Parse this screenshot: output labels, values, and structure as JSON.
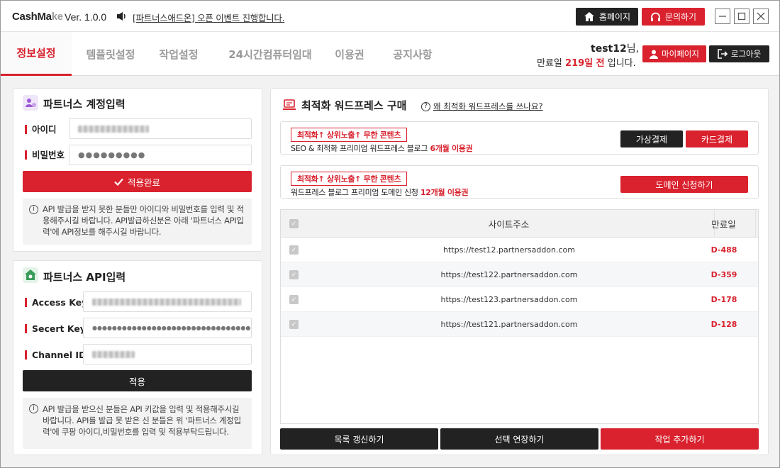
{
  "app": {
    "logo_prefix": "CashMa",
    "logo_suffix": "ke",
    "version": "Ver. 1.0.0",
    "notice": "[파트너스애드온] 오픈 이벤트 진행합니다."
  },
  "titlebar": {
    "home_label": "홈페이지",
    "ask_label": "문의하기"
  },
  "nav": {
    "tabs": [
      {
        "label": "정보설정",
        "active": true
      },
      {
        "label": "템플릿설정",
        "active": false
      },
      {
        "label": "작업설정",
        "active": false
      },
      {
        "label": "24시간컴퓨터임대",
        "active": false
      },
      {
        "label": "이용권",
        "active": false
      },
      {
        "label": "공지사항",
        "active": false
      }
    ],
    "username": "test12",
    "username_suffix": "님,",
    "expire_prefix": "만료일",
    "expire_value": "219일 전",
    "expire_suffix": "입니다.",
    "mypage_label": "마이페이지",
    "logout_label": "로그아웃"
  },
  "account": {
    "title": "파트너스 계정입력",
    "id_label": "아이디",
    "pw_label": "비밀번호",
    "pw_mask": "●●●●●●●●●",
    "apply_label": "적용완료",
    "info": "API 발급을 받지 못한 분들만 아이디와 비밀번호를 입력 및 적용해주시길 바랍니다.  API발급하신분은 아래 '파트너스 API입력'에 API정보를 해주시길 바랍니다."
  },
  "api": {
    "title": "파트너스 API입력",
    "access_label": "Access Key",
    "secret_label": "Secert Key",
    "secret_mask": "●●●●●●●●●●●●●●●●●●●●●●●●●●●●●●●●●●●●",
    "channel_label": "Channel ID",
    "apply_label": "적용",
    "info": "API 발급을 받으신 분들은 API 키값을 입력 및 적용해주시길 바랍니다. API를 발급 못 받은 신 분들은 위 '파트너스 계정입력'에 쿠팡 아이디,비밀번호를 입력 및 적용부탁드립니다."
  },
  "wordpress": {
    "title": "최적화 워드프레스 구매",
    "why_label": "왜 최적화 워드프레스를 쓰나요?",
    "promo1": {
      "badge": "최적화↑ 상위노출↑ 무한 콘텐츠",
      "desc_prefix": "SEO & 최적화 프리미엄 워드프레스 블로그",
      "desc_highlight": "6개월 이용권",
      "btn_virtual": "가상결제",
      "btn_card": "카드결제"
    },
    "promo2": {
      "badge": "최적화↑ 상위노출↑ 무한 콘텐츠",
      "desc_prefix": "워드프레스 블로그 프리미엄 도메인 신청",
      "desc_highlight": "12개월 이용권",
      "btn_domain": "도메인 신청하기"
    }
  },
  "table": {
    "col_site": "사이트주소",
    "col_expire": "만료일",
    "rows": [
      {
        "url": "https://test12.partnersaddon.com",
        "dday": "D-488"
      },
      {
        "url": "https://test122.partnersaddon.com",
        "dday": "D-359"
      },
      {
        "url": "https://test123.partnersaddon.com",
        "dday": "D-178"
      },
      {
        "url": "https://test121.partnersaddon.com",
        "dday": "D-128"
      }
    ]
  },
  "actions": {
    "refresh": "목록 갱신하기",
    "extend": "선택 연장하기",
    "add": "작업 추가하기"
  },
  "colors": {
    "accent": "#d9222e",
    "dark": "#222222"
  }
}
